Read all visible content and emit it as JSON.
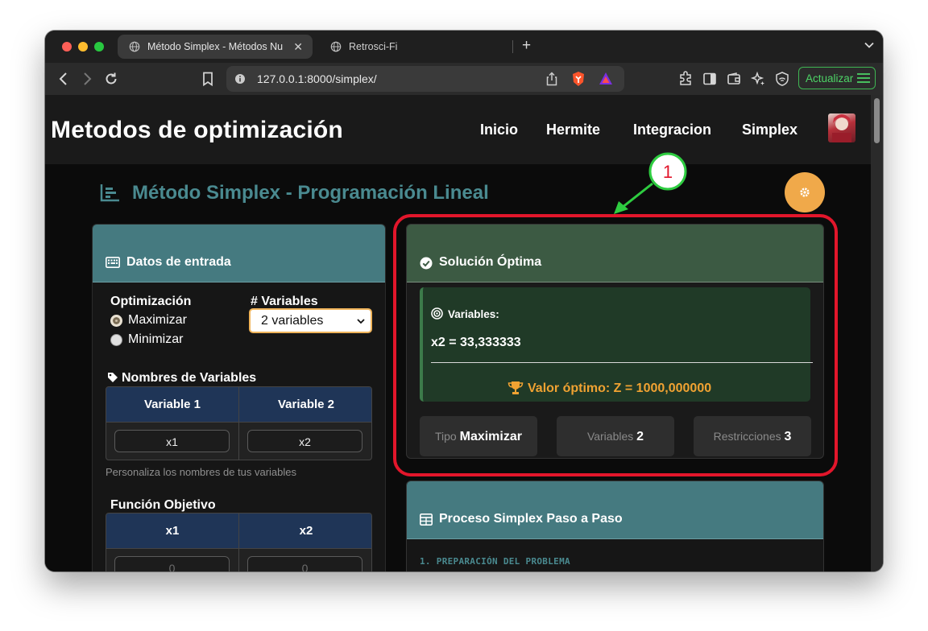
{
  "browser": {
    "tabs": [
      {
        "title": "Método Simplex - Métodos Nu",
        "active": true
      },
      {
        "title": "Retrosci-Fi",
        "active": false
      }
    ],
    "url": "127.0.0.1:8000/simplex/",
    "update_label": "Actualizar",
    "accent": "#3fb653"
  },
  "nav": {
    "brand": "Metodos de optimización",
    "links": [
      "Inicio",
      "Hermite",
      "Integracion",
      "Simplex"
    ]
  },
  "page": {
    "title": "Método Simplex - Programación Lineal",
    "title_color": "#4a8a90",
    "gear_color": "#f0a94a"
  },
  "input_card": {
    "header": "Datos de entrada",
    "optimization_label": "Optimización",
    "options": [
      "Maximizar",
      "Minimizar"
    ],
    "selected_option": "Maximizar",
    "variables_label": "# Variables",
    "variables_value": "2 variables",
    "names_label": "Nombres de Variables",
    "names_headers": [
      "Variable 1",
      "Variable 2"
    ],
    "names_values": [
      "x1",
      "x2"
    ],
    "names_hint": "Personaliza los nombres de tus variables",
    "objective_label": "Función Objetivo",
    "objective_headers": [
      "x1",
      "x2"
    ],
    "objective_placeholders": [
      "0",
      "0"
    ]
  },
  "solution_card": {
    "header": "Solución Óptima",
    "variables_label": "Variables:",
    "solution_line": "x2 = 33,333333",
    "optimal_value": "Valor óptimo: Z = 1000,000000",
    "stats": [
      {
        "label": "Tipo",
        "value": "Maximizar"
      },
      {
        "label": "Variables",
        "value": "2"
      },
      {
        "label": "Restricciones",
        "value": "3"
      }
    ],
    "highlight_color": "#e2162b"
  },
  "process_card": {
    "header": "Proceso Simplex Paso a Paso",
    "first_step": "1. PREPARACIÓN DEL PROBLEMA"
  },
  "annotation": {
    "number": "1",
    "color": "#2ecc40"
  }
}
